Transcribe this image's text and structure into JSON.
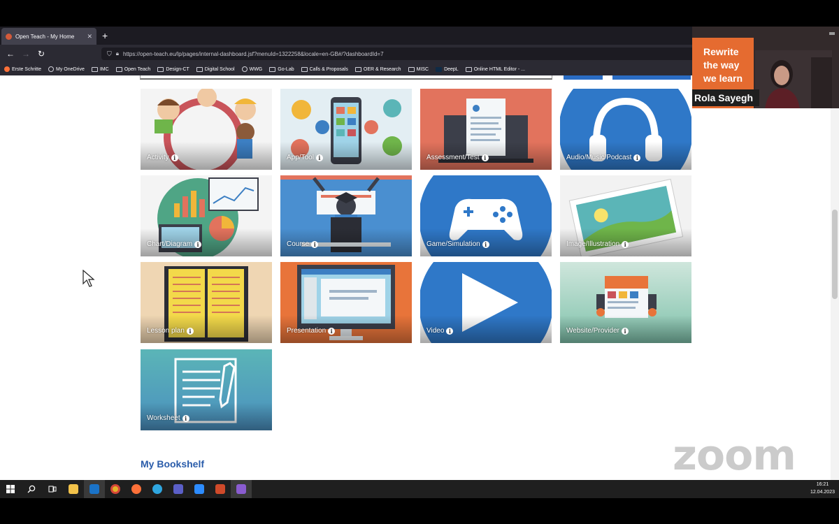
{
  "browser": {
    "tab_title": "Open Teach - My Home",
    "tab_close": "✕",
    "new_tab": "+",
    "url": "https://open-teach.eu/lp/pages/internal-dashboard.jsf?menuId=1322258&locale=en-GB#/?dashboardId=7",
    "bookmarks": [
      "Erste Schritte",
      "My OneDrive",
      "IMC",
      "Open Teach",
      "Design-CT",
      "Digital School",
      "WWG",
      "Go-Lab",
      "Calls & Proposals",
      "OER & Research",
      "MISC",
      "DeepL",
      "Online HTML Editor - ..."
    ]
  },
  "tiles": [
    {
      "label": "Activity",
      "info": "i"
    },
    {
      "label": "App/Tool",
      "info": "i"
    },
    {
      "label": "Assessment/Test",
      "info": "i"
    },
    {
      "label": "Audio/Music/Podcast",
      "info": "i"
    },
    {
      "label": "Chart/Diagram",
      "info": "i"
    },
    {
      "label": "Course",
      "info": "i"
    },
    {
      "label": "Game/Simulation",
      "info": "i"
    },
    {
      "label": "Image/Illustration",
      "info": "i"
    },
    {
      "label": "Lesson plan",
      "info": "i"
    },
    {
      "label": "Presentation",
      "info": "i"
    },
    {
      "label": "Video",
      "info": "i"
    },
    {
      "label": "Website/Provider",
      "info": "i"
    },
    {
      "label": "Worksheet",
      "info": "i"
    }
  ],
  "section_title": "My Bookshelf",
  "webcam": {
    "slogan": "Rewrite\nthe way\nwe learn",
    "participant_name": "Rola Sayegh"
  },
  "watermark": "zoom",
  "taskbar": {
    "time": "16:21",
    "date": "12.04.2023"
  },
  "colors": {
    "accent": "#2a5caa",
    "tile_blue": "#2f78c8",
    "tile_red": "#e2735d",
    "tile_orange": "#e8743a",
    "tile_teal": "#5bb5b7"
  }
}
